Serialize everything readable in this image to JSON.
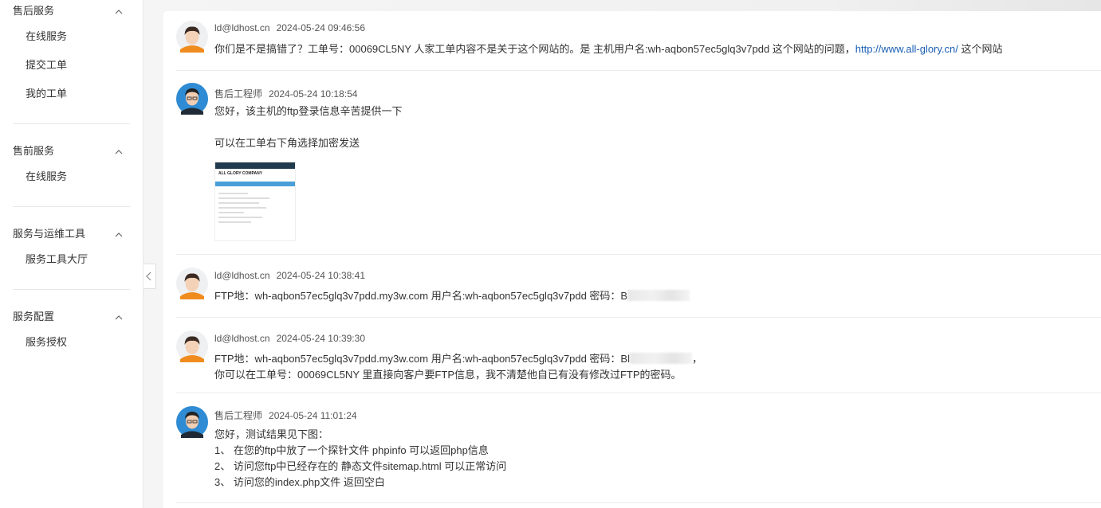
{
  "sidebar": {
    "groups": [
      {
        "title": "售后服务",
        "items": [
          "在线服务",
          "提交工单",
          "我的工单"
        ]
      },
      {
        "title": "售前服务",
        "items": [
          "在线服务"
        ]
      },
      {
        "title": "服务与运维工具",
        "items": [
          "服务工具大厅"
        ]
      },
      {
        "title": "服务配置",
        "items": [
          "服务授权"
        ]
      }
    ]
  },
  "messages": [
    {
      "author": "ld@ldhost.cn",
      "time": "2024-05-24 09:46:56",
      "role": "customer",
      "line1_text": "你们是不是搞错了？工单号：00069CL5NY  人家工单内容不是关于这个网站的。是 主机用户名:wh-aqbon57ec5glq3v7pdd 这个网站的问题，",
      "line1_link": "http://www.all-glory.cn/",
      "line1_tail": " 这个网站"
    },
    {
      "author": "售后工程师",
      "time": "2024-05-24 10:18:54",
      "role": "engineer",
      "line1": "您好，该主机的ftp登录信息辛苦提供一下",
      "line2": "可以在工单右下角选择加密发送",
      "thumb_title": "ALL GLORY COMPANY"
    },
    {
      "author": "ld@ldhost.cn",
      "time": "2024-05-24 10:38:41",
      "role": "customer",
      "line1": "FTP地：wh-aqbon57ec5glq3v7pdd.my3w.com    用户名:wh-aqbon57ec5glq3v7pdd  密码：B"
    },
    {
      "author": "ld@ldhost.cn",
      "time": "2024-05-24 10:39:30",
      "role": "customer",
      "line1": "FTP地：wh-aqbon57ec5glq3v7pdd.my3w.com    用户名:wh-aqbon57ec5glq3v7pdd  密码：Bl",
      "line1_tail": "，",
      "line2": "你可以在工单号：00069CL5NY  里直接向客户要FTP信息，我不清楚他自已有没有修改过FTP的密码。"
    },
    {
      "author": "售后工程师",
      "time": "2024-05-24 11:01:24",
      "role": "engineer",
      "line1": "您好，测试结果见下图：",
      "line2": "1、  在您的ftp中放了一个探针文件 phpinfo 可以返回php信息",
      "line3": "2、  访问您ftp中已经存在的 静态文件sitemap.html 可以正常访问",
      "line4": "3、  访问您的index.php文件 返回空白"
    }
  ],
  "colors": {
    "link": "#1a5fb4",
    "accent_customer": "#f39c12",
    "accent_engineer": "#2b6cb0"
  }
}
